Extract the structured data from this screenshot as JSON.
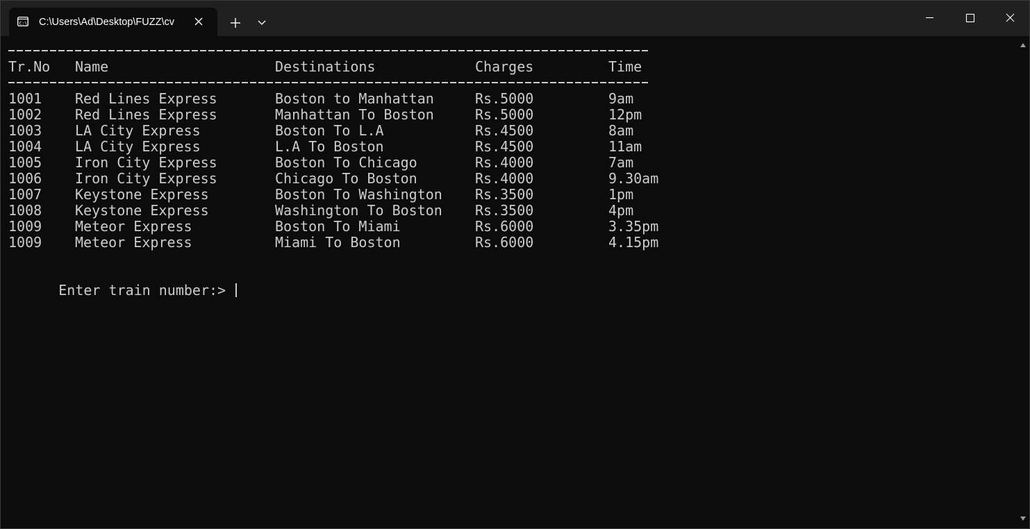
{
  "window": {
    "tab_title": "C:\\Users\\Ad\\Desktop\\FUZZ\\cv"
  },
  "terminal": {
    "header": {
      "trno": "Tr.No",
      "name": "Name",
      "destinations": "Destinations",
      "charges": "Charges",
      "time": "Time"
    },
    "rows": [
      {
        "trno": "1001",
        "name": "Red Lines Express",
        "destination": "Boston to Manhattan",
        "charges": "Rs.5000",
        "time": "9am"
      },
      {
        "trno": "1002",
        "name": "Red Lines Express",
        "destination": "Manhattan To Boston",
        "charges": "Rs.5000",
        "time": "12pm"
      },
      {
        "trno": "1003",
        "name": "LA City Express",
        "destination": "Boston To L.A",
        "charges": "Rs.4500",
        "time": "8am"
      },
      {
        "trno": "1004",
        "name": "LA City Express",
        "destination": "L.A To Boston",
        "charges": "Rs.4500",
        "time": "11am"
      },
      {
        "trno": "1005",
        "name": "Iron City Express",
        "destination": "Boston To Chicago",
        "charges": "Rs.4000",
        "time": "7am"
      },
      {
        "trno": "1006",
        "name": "Iron City Express",
        "destination": "Chicago To Boston",
        "charges": "Rs.4000",
        "time": "9.30am"
      },
      {
        "trno": "1007",
        "name": "Keystone Express",
        "destination": "Boston To Washington",
        "charges": "Rs.3500",
        "time": "1pm"
      },
      {
        "trno": "1008",
        "name": "Keystone Express",
        "destination": "Washington To Boston",
        "charges": "Rs.3500",
        "time": "4pm"
      },
      {
        "trno": "1009",
        "name": "Meteor Express",
        "destination": "Boston To Miami",
        "charges": "Rs.6000",
        "time": "3.35pm"
      },
      {
        "trno": "1009",
        "name": "Meteor Express",
        "destination": "Miami To Boston",
        "charges": "Rs.6000",
        "time": "4.15pm"
      }
    ],
    "prompt": "Enter train number:> "
  },
  "colors": {
    "background": "#0c0c0c",
    "titlebar": "#202020",
    "text": "#cccccc"
  }
}
